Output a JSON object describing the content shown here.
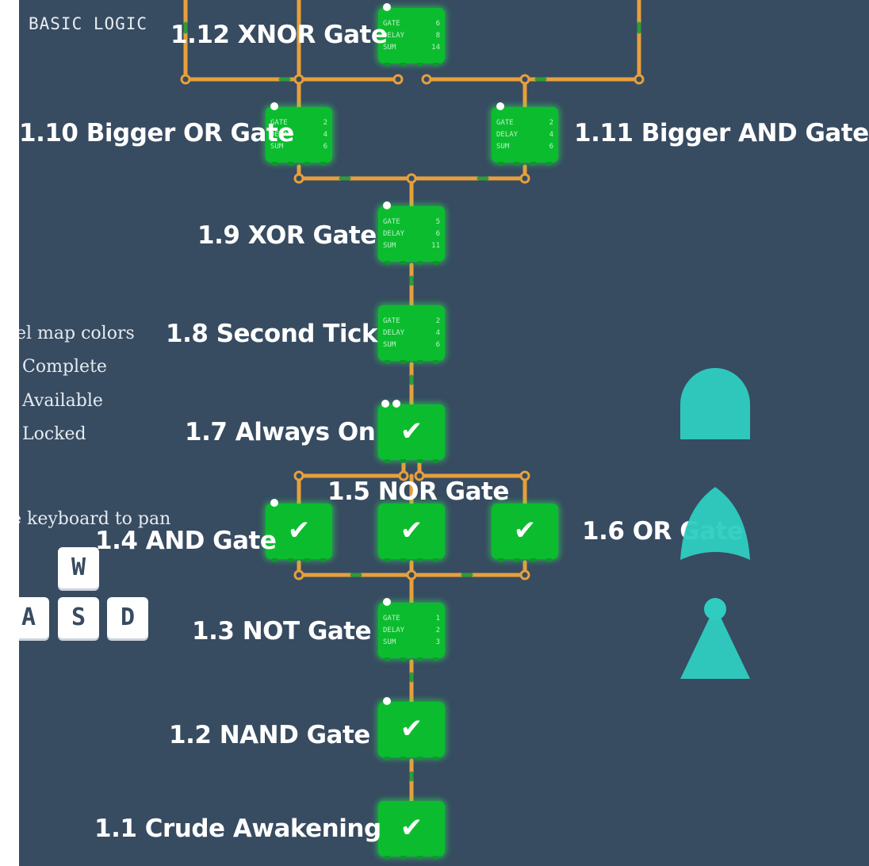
{
  "section_title": "BASIC LOGIC",
  "levels": [
    {
      "id": "1.1",
      "label": "1.1 Crude Awakening",
      "state": "complete"
    },
    {
      "id": "1.2",
      "label": "1.2 NAND Gate",
      "state": "complete"
    },
    {
      "id": "1.3",
      "label": "1.3 NOT Gate",
      "state": "stats",
      "stats": {
        "gate_label": "GATE",
        "gate": "1",
        "delay_label": "DELAY",
        "delay": "2",
        "sum_label": "SUM",
        "sum": "3"
      }
    },
    {
      "id": "1.4",
      "label": "1.4 AND Gate",
      "state": "complete"
    },
    {
      "id": "1.5",
      "label": "1.5 NOR Gate",
      "state": "complete"
    },
    {
      "id": "1.6",
      "label": "1.6 OR Gate",
      "state": "complete"
    },
    {
      "id": "1.7",
      "label": "1.7 Always On",
      "state": "complete"
    },
    {
      "id": "1.8",
      "label": "1.8 Second Tick",
      "state": "stats",
      "stats": {
        "gate_label": "GATE",
        "gate": "2",
        "delay_label": "DELAY",
        "delay": "4",
        "sum_label": "SUM",
        "sum": "6"
      }
    },
    {
      "id": "1.9",
      "label": "1.9 XOR Gate",
      "state": "stats",
      "stats": {
        "gate_label": "GATE",
        "gate": "5",
        "delay_label": "DELAY",
        "delay": "6",
        "sum_label": "SUM",
        "sum": "11"
      }
    },
    {
      "id": "1.10",
      "label": "1.10 Bigger OR Gate",
      "state": "stats",
      "stats": {
        "gate_label": "GATE",
        "gate": "2",
        "delay_label": "DELAY",
        "delay": "4",
        "sum_label": "SUM",
        "sum": "6"
      }
    },
    {
      "id": "1.11",
      "label": "1.11 Bigger AND Gate",
      "state": "stats",
      "stats": {
        "gate_label": "GATE",
        "gate": "2",
        "delay_label": "DELAY",
        "delay": "4",
        "sum_label": "SUM",
        "sum": "6"
      }
    },
    {
      "id": "1.12",
      "label": "1.12 XNOR Gate",
      "state": "stats",
      "stats": {
        "gate_label": "GATE",
        "gate": "6",
        "delay_label": "DELAY",
        "delay": "8",
        "sum_label": "SUM",
        "sum": "14"
      }
    }
  ],
  "legend": {
    "title": "el map colors",
    "complete": "Complete",
    "available": "Available",
    "locked": "Locked"
  },
  "keyboard_hint": "e keyboard to pan",
  "keys": {
    "w": "W",
    "a": "A",
    "s": "S",
    "d": "D"
  },
  "check_glyph": "✔",
  "colors": {
    "background": "#374b61",
    "node": "#0bbd2e",
    "wire": "#e7a03c",
    "wire_joint": "#2f9b3b",
    "gate_shape": "#2ecdc0"
  },
  "icons": [
    "and-gate-shape-icon",
    "or-gate-shape-icon",
    "not-gate-shape-icon"
  ]
}
